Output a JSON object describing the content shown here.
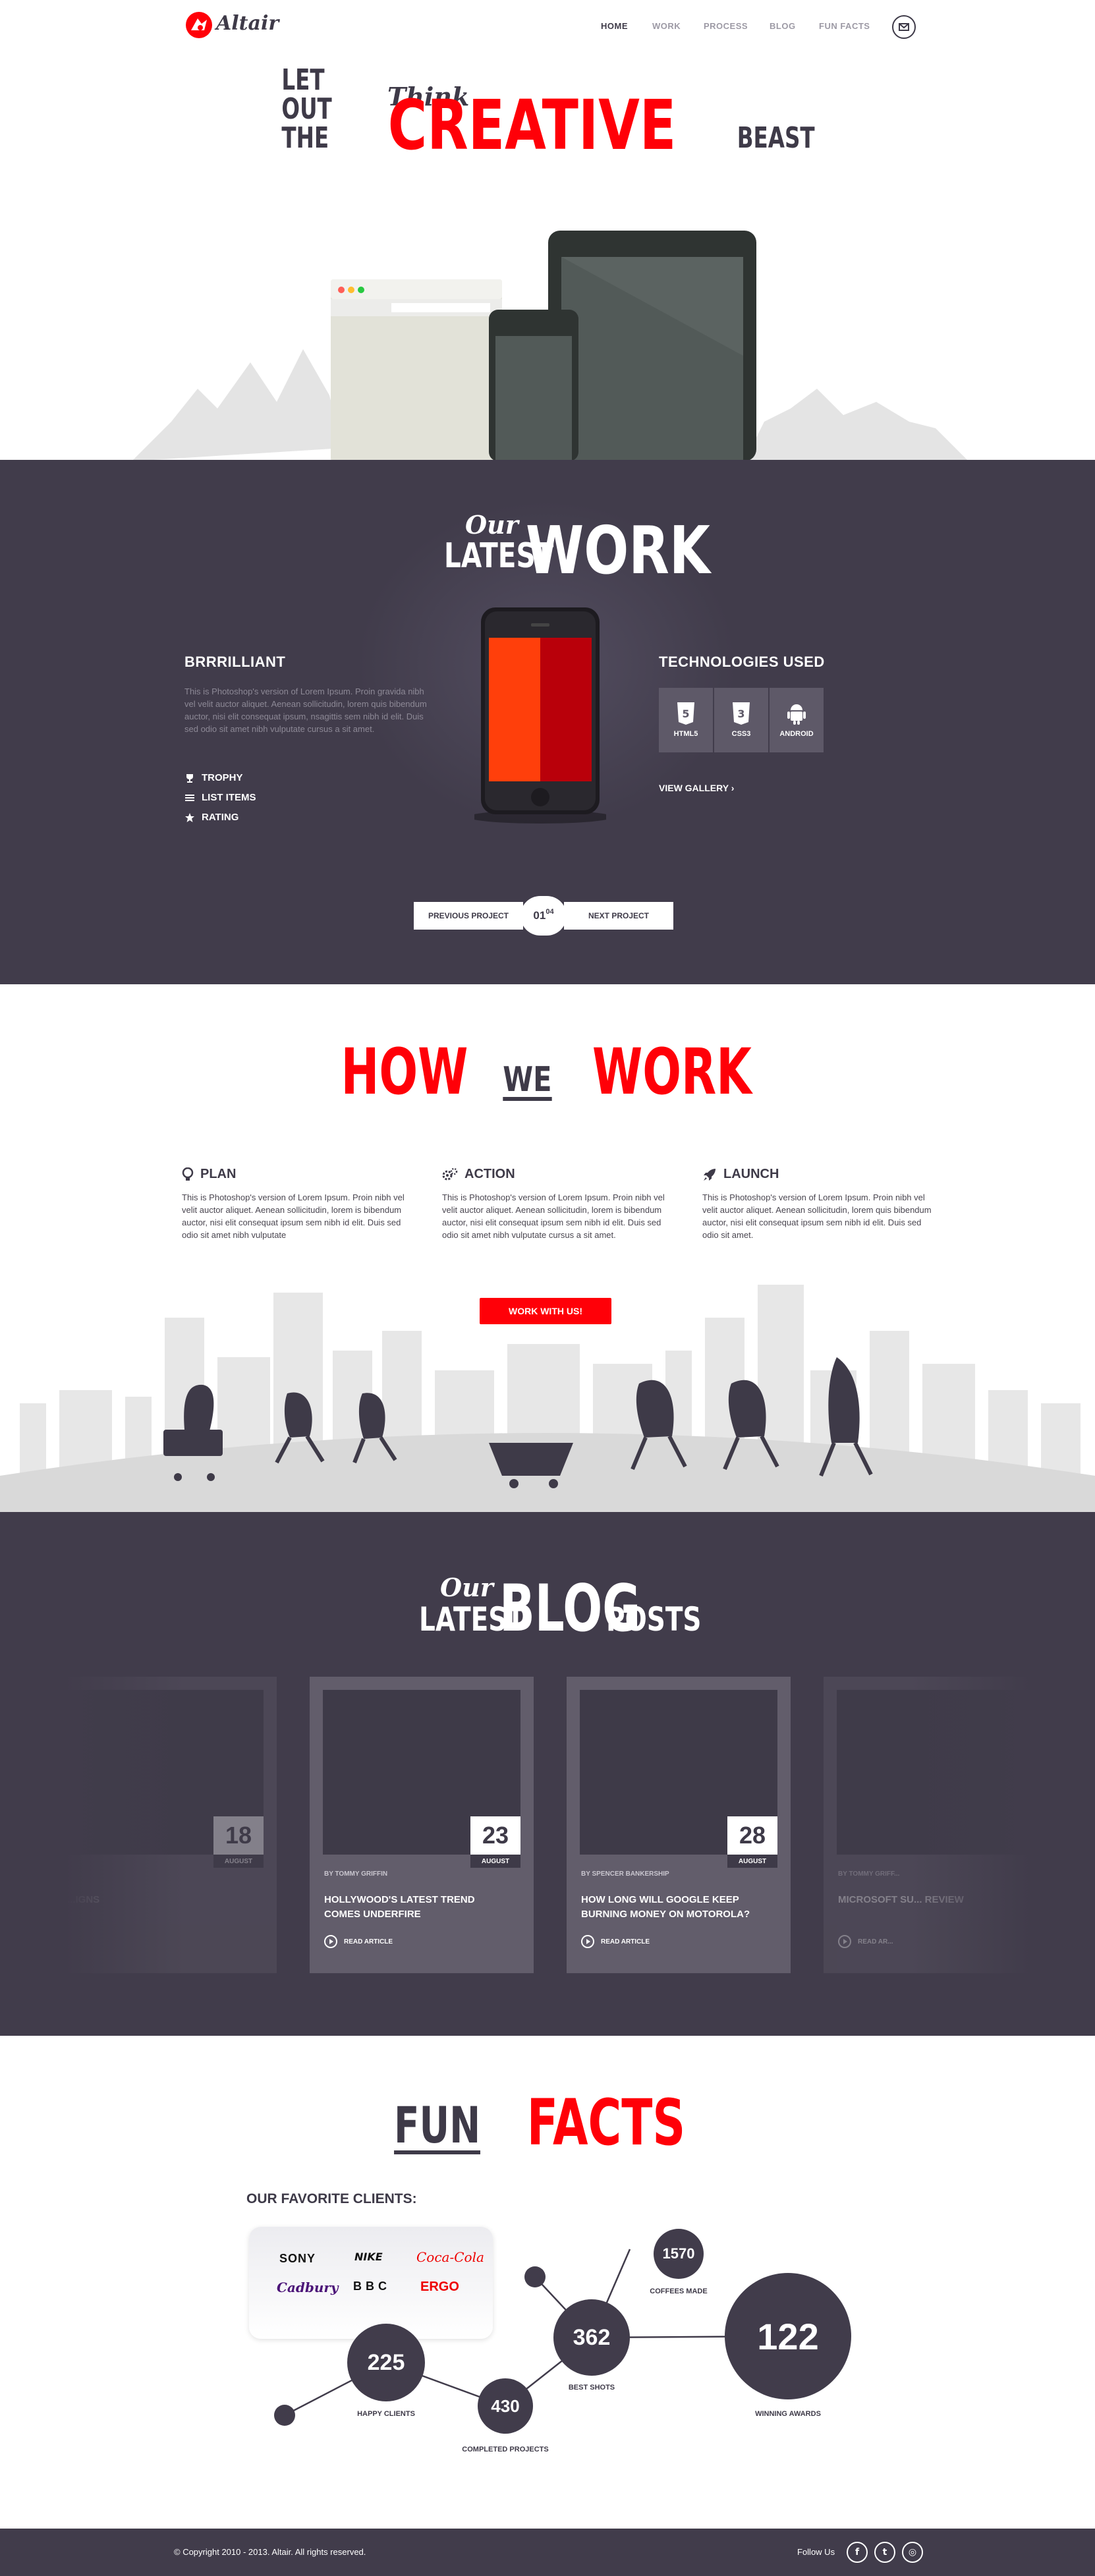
{
  "header": {
    "logo_text": "Altair",
    "nav": [
      {
        "label": "HOME"
      },
      {
        "label": "WORK"
      },
      {
        "label": "PROCESS"
      },
      {
        "label": "BLOG"
      },
      {
        "label": "FUN FACTS"
      }
    ],
    "mail_icon": "envelope-icon"
  },
  "hero": {
    "think": "Think",
    "before": "LET OUT THE",
    "creative": "CREATIVE",
    "after": "BEAST"
  },
  "work": {
    "title_small": "Our",
    "title_latest": "LATEST",
    "title_big": "WORK",
    "project_name": "BRRRILLIANT",
    "project_desc": "This is Photoshop's version of Lorem Ipsum. Proin gravida nibh vel velit auctor aliquet. Aenean sollicitudin, lorem quis bibendum auctor, nisi elit consequat ipsum, nsagittis sem nibh id elit. Duis sed odio sit amet nibh vulputate cursus a sit amet.",
    "features": [
      {
        "label": "TROPHY",
        "icon": "trophy-icon"
      },
      {
        "label": "LIST ITEMS",
        "icon": "list-icon"
      },
      {
        "label": "RATING",
        "icon": "star-icon"
      }
    ],
    "tech_heading": "TECHNOLOGIES USED",
    "technologies": [
      {
        "label": "HTML5",
        "icon": "html5-icon"
      },
      {
        "label": "CSS3",
        "icon": "css3-icon"
      },
      {
        "label": "ANDROID",
        "icon": "android-icon"
      }
    ],
    "gallery_link": "VIEW GALLERY",
    "prev": "PREVIOUS PROJECT",
    "next": "NEXT PROJECT",
    "counter_current": "01",
    "counter_total": "04"
  },
  "how": {
    "title_how": "HOW",
    "title_we": "WE",
    "title_work": "WORK",
    "steps": [
      {
        "title": "PLAN",
        "icon": "lightbulb-icon",
        "text": "This is Photoshop's version of Lorem Ipsum. Proin nibh vel velit auctor aliquet. Aenean sollicitudin, lorem is bibendum auctor, nisi elit consequat ipsum sem nibh id elit. Duis sed odio sit amet nibh vulputate"
      },
      {
        "title": "ACTION",
        "icon": "gears-icon",
        "text": "This is Photoshop's version of Lorem Ipsum. Proin nibh vel velit auctor aliquet. Aenean sollicitudin, lorem is bibendum auctor, nisi elit consequat ipsum sem nibh id elit. Duis sed odio sit amet nibh vulputate cursus a sit amet."
      },
      {
        "title": "LAUNCH",
        "icon": "rocket-icon",
        "text": "This is Photoshop's version of Lorem Ipsum. Proin nibh vel velit auctor aliquet. Aenean sollicitudin, lorem quis bibendum auctor, nisi elit consequat ipsum sem nibh id elit. Duis sed odio sit amet."
      }
    ],
    "cta": "WORK WITH US!"
  },
  "blog": {
    "title_small": "Our",
    "title_latest": "LATEST",
    "title_big": "BLOG",
    "title_posts": "POSTS",
    "posts": [
      {
        "day": "18",
        "month": "AUGUST",
        "author": "",
        "title": "...IGNS",
        "read": ""
      },
      {
        "day": "23",
        "month": "AUGUST",
        "author": "BY TOMMY GRIFFIN",
        "title": "HOLLYWOOD'S LATEST TREND COMES UNDERFIRE",
        "read": "READ ARTICLE"
      },
      {
        "day": "28",
        "month": "AUGUST",
        "author": "BY SPENCER BANKERSHIP",
        "title": "HOW LONG WILL GOOGLE KEEP BURNING MONEY ON MOTOROLA?",
        "read": "READ ARTICLE"
      },
      {
        "day": "",
        "month": "",
        "author": "BY TOMMY GRIFF...",
        "title": "MICROSOFT SU... REVIEW",
        "read": "READ AR..."
      }
    ]
  },
  "facts": {
    "title_fun": "FUN",
    "title_facts": "FACTS",
    "clients_heading": "OUR FAVORITE CLIENTS:",
    "clients": [
      "SONY",
      "NIKE",
      "Coca-Cola",
      "Cadbury",
      "BBC",
      "ERGO"
    ],
    "stats": [
      {
        "value": "225",
        "label": "HAPPY CLIENTS"
      },
      {
        "value": "430",
        "label": "COMPLETED PROJECTS"
      },
      {
        "value": "362",
        "label": "BEST SHOTS"
      },
      {
        "value": "1570",
        "label": "COFFEES MADE"
      },
      {
        "value": "122",
        "label": "WINNING AWARDS"
      }
    ]
  },
  "footer": {
    "copyright": "© Copyright 2010 - 2013. Altair. All rights reserved.",
    "follow": "Follow Us",
    "social": [
      {
        "icon": "facebook-icon",
        "glyph": "f"
      },
      {
        "icon": "twitter-icon",
        "glyph": "t"
      },
      {
        "icon": "dribbble-icon",
        "glyph": "◎"
      }
    ]
  },
  "colors": {
    "accent": "#ff0008",
    "dark": "#413c4b",
    "card": "#625d6b"
  }
}
